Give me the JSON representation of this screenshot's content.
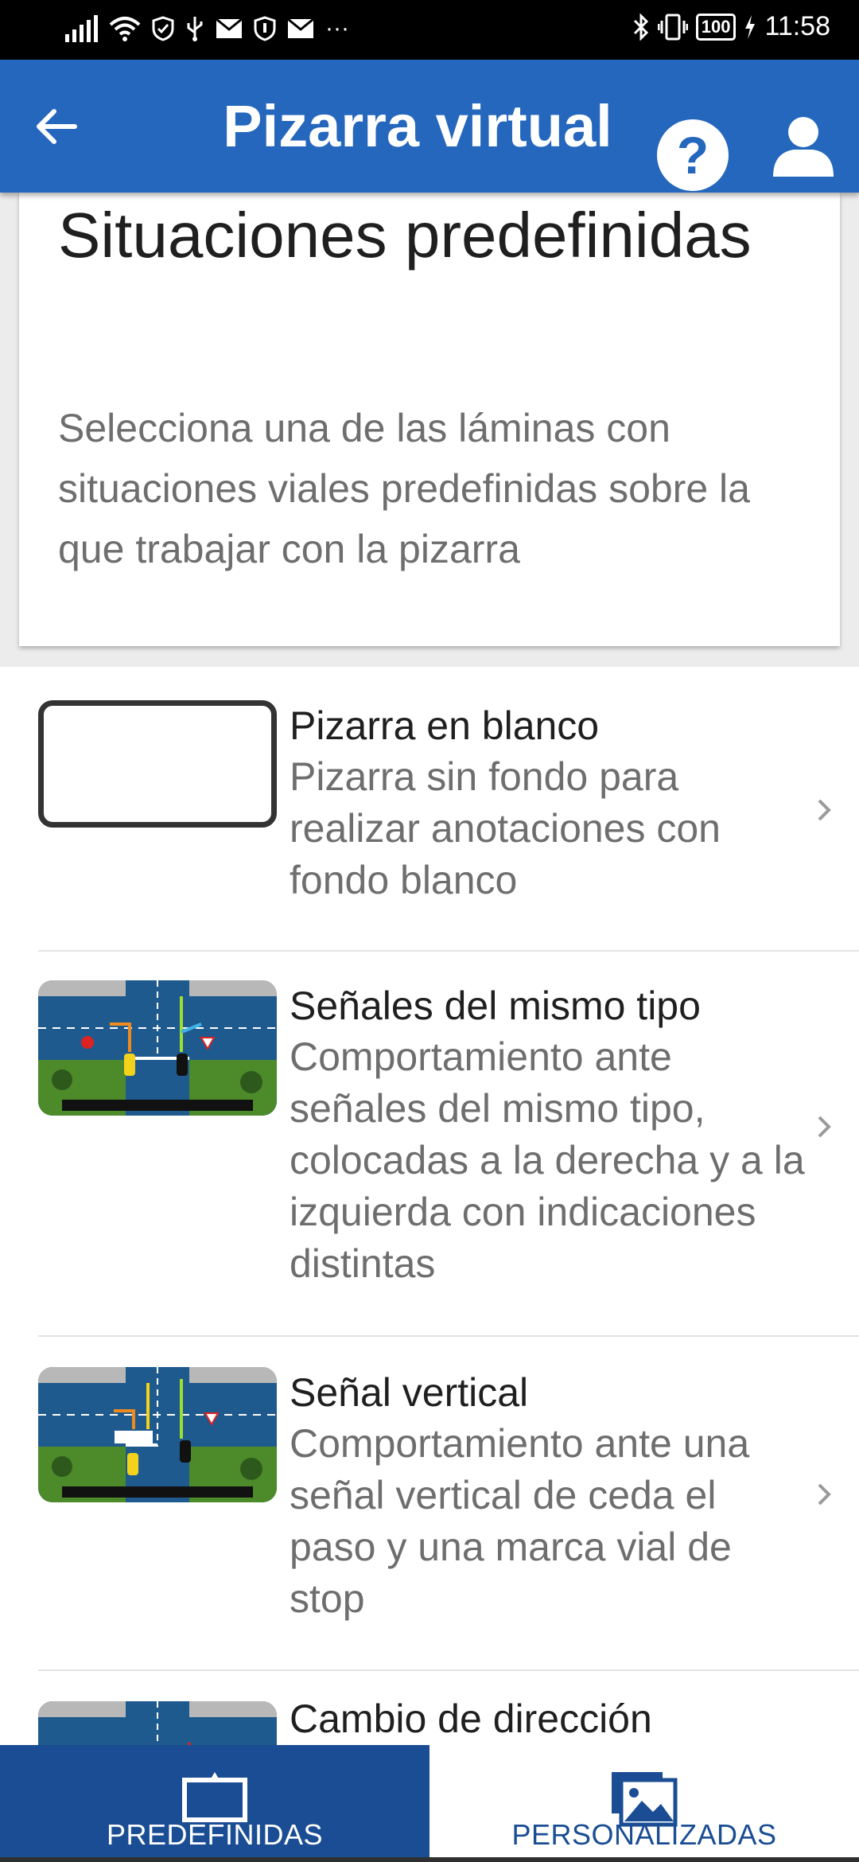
{
  "status_bar": {
    "time": "11:58",
    "battery": "100",
    "icons": [
      "signal-icon",
      "wifi-icon",
      "shield-icon",
      "usb-icon",
      "mail-icon",
      "shield-icon",
      "mail-icon",
      "more-icon",
      "bluetooth-icon",
      "vibrate-icon",
      "battery-icon",
      "charging-icon"
    ],
    "more": "···"
  },
  "app_bar": {
    "title": "Pizarra virtual",
    "back_icon": "arrow-left-icon",
    "help_label": "?",
    "user_icon": "user-icon",
    "color": "#2467bd"
  },
  "header": {
    "title": "Situaciones predefinidas",
    "description": "Selecciona una de las láminas con situaciones viales predefinidas sobre la que trabajar con la pizarra"
  },
  "list": {
    "items": [
      {
        "title": "Pizarra en blanco",
        "description": "Pizarra sin fondo para realizar anotaciones con fondo blanco",
        "thumbnail": "blank-board"
      },
      {
        "title": "Señales del mismo tipo",
        "description": "Comportamiento ante señales del mismo tipo, colocadas a la derecha y a la izquierda con indicaciones distintas",
        "thumbnail": "intersection-stop-yield"
      },
      {
        "title": "Señal vertical",
        "description": "Comportamiento ante una señal vertical de ceda el paso y una marca vial de stop",
        "thumbnail": "intersection-yield-stop-mark"
      },
      {
        "title": "Cambio de dirección",
        "description": "",
        "thumbnail": "intersection-turn"
      }
    ]
  },
  "bottom_nav": {
    "tabs": [
      {
        "label": "PREDEFINIDAS",
        "icon": "board-icon",
        "active": true
      },
      {
        "label": "PERSONALIZADAS",
        "icon": "gallery-icon",
        "active": false
      }
    ],
    "active_color": "#1a4d94"
  }
}
